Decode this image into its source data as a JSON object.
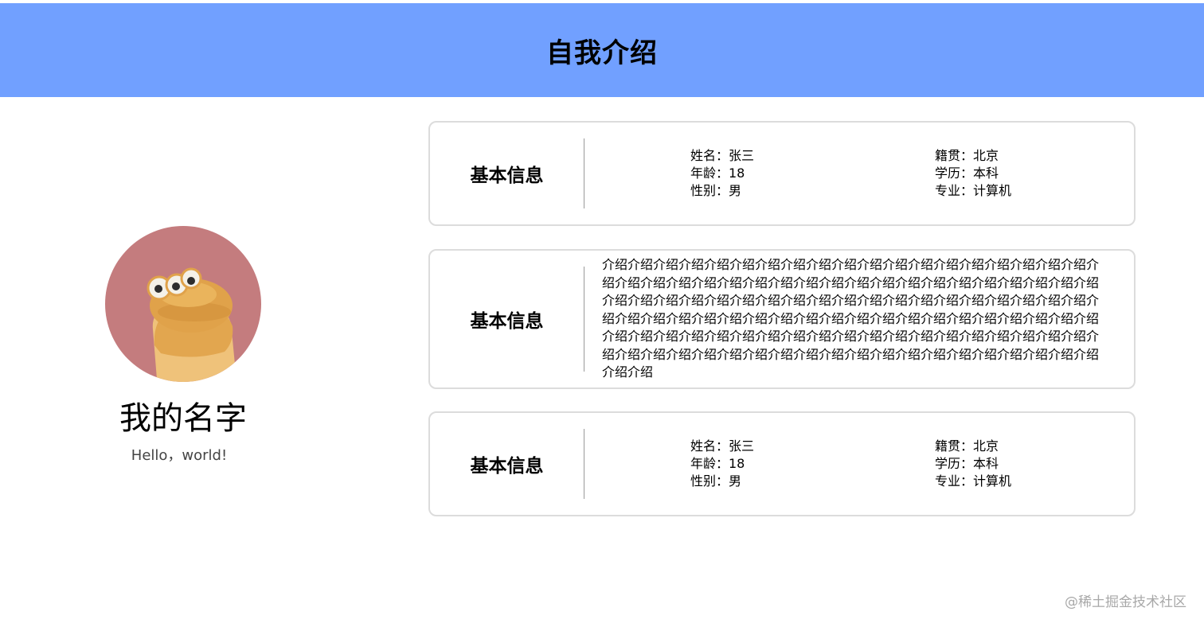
{
  "header": {
    "title": "自我介绍"
  },
  "profile": {
    "name": "我的名字",
    "motto": "Hello，world!"
  },
  "cards": [
    {
      "title": "基本信息",
      "left": [
        "姓名：张三",
        "年龄：18",
        "性别：男"
      ],
      "right": [
        "籍贯：北京",
        "学历：本科",
        "专业：计算机"
      ]
    },
    {
      "title": "基本信息",
      "text": "介绍介绍介绍介绍介绍介绍介绍介绍介绍介绍介绍介绍介绍介绍介绍介绍介绍介绍介绍介绍介绍介绍介绍介绍介绍介绍介绍介绍介绍介绍介绍介绍介绍介绍介绍介绍介绍介绍介绍介绍介绍介绍介绍介绍介绍介绍介绍介绍介绍介绍介绍介绍介绍介绍介绍介绍介绍介绍介绍介绍介绍介绍介绍介绍介绍介绍介绍介绍介绍介绍介绍介绍介绍介绍介绍介绍介绍介绍介绍介绍介绍介绍介绍介绍介绍介绍介绍介绍介绍介绍介绍介绍介绍介绍介绍介绍介绍介绍介绍介绍介绍介绍介绍介绍介绍介绍介绍介绍介绍介绍介绍介绍介绍介绍介绍介绍介绍介绍介绍"
    },
    {
      "title": "基本信息",
      "left": [
        "姓名：张三",
        "年龄：18",
        "性别：男"
      ],
      "right": [
        "籍贯：北京",
        "学历：本科",
        "专业：计算机"
      ]
    }
  ],
  "watermark": "@稀土掘金技术社区",
  "colors": {
    "header_bg": "#71a0ff",
    "avatar_bg": "#c47c7e",
    "card_border": "#dcdcdc"
  }
}
